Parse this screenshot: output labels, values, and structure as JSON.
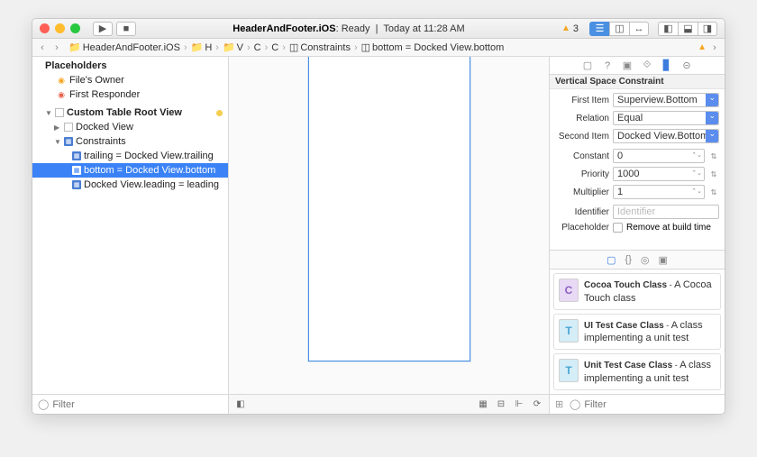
{
  "titlebar": {
    "project": "HeaderAndFooter.iOS",
    "status": "Ready",
    "time": "Today at 11:28 AM",
    "warning_count": "3"
  },
  "jumpbar": {
    "segments": [
      "HeaderAndFooter.iOS",
      "H",
      "V",
      "C",
      "C",
      "Constraints",
      "bottom = Docked View.bottom"
    ]
  },
  "navigator": {
    "placeholders_header": "Placeholders",
    "files_owner": "File's Owner",
    "first_responder": "First Responder",
    "root_view": "Custom Table Root View",
    "docked_view": "Docked View",
    "constraints": "Constraints",
    "c_trailing": "trailing = Docked View.trailing",
    "c_bottom": "bottom = Docked View.bottom",
    "c_leading": "Docked View.leading = leading",
    "filter_placeholder": "Filter"
  },
  "inspector": {
    "section_title": "Vertical Space Constraint",
    "first_item_label": "First Item",
    "first_item": "Superview.Bottom",
    "relation_label": "Relation",
    "relation": "Equal",
    "second_item_label": "Second Item",
    "second_item": "Docked View.Bottom",
    "constant_label": "Constant",
    "constant": "0",
    "priority_label": "Priority",
    "priority": "1000",
    "multiplier_label": "Multiplier",
    "multiplier": "1",
    "identifier_label": "Identifier",
    "identifier_placeholder": "Identifier",
    "placeholder_label": "Placeholder",
    "remove_label": "Remove at build time"
  },
  "library": {
    "items": [
      {
        "icon": "C",
        "title": "Cocoa Touch Class",
        "desc": "A Cocoa Touch class"
      },
      {
        "icon": "T",
        "title": "UI Test Case Class",
        "desc": "A class implementing a unit test"
      },
      {
        "icon": "T",
        "title": "Unit Test Case Class",
        "desc": "A class implementing a unit test"
      }
    ],
    "filter_placeholder": "Filter"
  }
}
